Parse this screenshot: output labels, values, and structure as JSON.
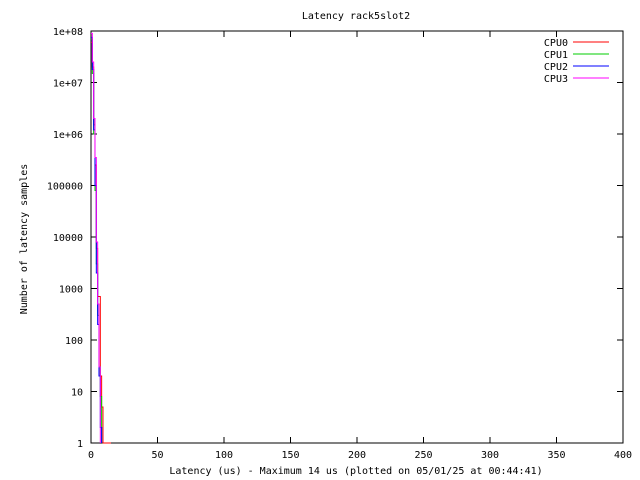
{
  "chart_data": {
    "type": "line",
    "title": "Latency rack5slot2",
    "xlabel": "Latency (us) - Maximum 14 us (plotted on 05/01/25 at 00:44:41)",
    "ylabel": "Number of latency samples",
    "xlim": [
      0,
      400
    ],
    "ylim": [
      1,
      100000000
    ],
    "yscale": "log",
    "xticks": [
      0,
      50,
      100,
      150,
      200,
      250,
      300,
      350,
      400
    ],
    "yticks": [
      {
        "value": 1,
        "label": "1"
      },
      {
        "value": 10,
        "label": "10"
      },
      {
        "value": 100,
        "label": "100"
      },
      {
        "value": 1000,
        "label": "1000"
      },
      {
        "value": 10000,
        "label": "10000"
      },
      {
        "value": 100000,
        "label": "100000"
      },
      {
        "value": 1000000,
        "label": "1e+06"
      },
      {
        "value": 10000000,
        "label": "1e+07"
      },
      {
        "value": 100000000,
        "label": "1e+08"
      }
    ],
    "grid": false,
    "legend": "top-right",
    "series": [
      {
        "name": "CPU0",
        "color": "#ff0000",
        "x": [
          0,
          1,
          2,
          3,
          4,
          5,
          6,
          7,
          8,
          9,
          10,
          11,
          12,
          13,
          14
        ],
        "y": [
          60000000,
          20000000,
          1500000,
          250000,
          6000,
          700,
          700,
          20,
          5,
          1,
          1,
          1,
          1,
          1,
          1
        ]
      },
      {
        "name": "CPU1",
        "color": "#00cc00",
        "x": [
          0,
          1,
          2,
          3,
          4,
          5,
          6,
          7
        ],
        "y": [
          70000000,
          15000000,
          1000000,
          80000,
          3000,
          300,
          30,
          8
        ]
      },
      {
        "name": "CPU2",
        "color": "#0000ff",
        "x": [
          0,
          1,
          2,
          3,
          4,
          5,
          6,
          7
        ],
        "y": [
          75000000,
          18000000,
          1200000,
          100000,
          2000,
          200,
          20,
          2
        ]
      },
      {
        "name": "CPU3",
        "color": "#ff00ff",
        "x": [
          0,
          1,
          2,
          3,
          4,
          5,
          6
        ],
        "y": [
          90000000,
          25000000,
          2000000,
          350000,
          8000,
          500,
          30
        ]
      }
    ]
  }
}
